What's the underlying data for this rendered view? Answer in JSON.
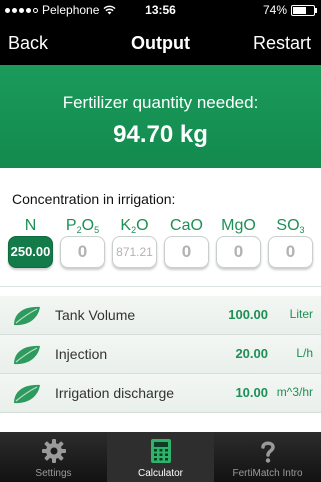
{
  "status_bar": {
    "carrier": "Pelephone",
    "time": "13:56",
    "battery": "74%",
    "battery_level": 0.74
  },
  "nav": {
    "back_label": "Back",
    "title": "Output",
    "restart_label": "Restart"
  },
  "hero": {
    "label": "Fertilizer quantity needed:",
    "value": "94.70 kg"
  },
  "concentration": {
    "title": "Concentration in irrigation:",
    "elements": [
      {
        "symbol": "N",
        "sub": "",
        "symbol2": "",
        "sub2": "",
        "value": "250.00"
      },
      {
        "symbol": "P",
        "sub": "2",
        "symbol2": "O",
        "sub2": "5",
        "value": "0"
      },
      {
        "symbol": "K",
        "sub": "2",
        "symbol2": "O",
        "sub2": "",
        "value": "871.21"
      },
      {
        "symbol": "CaO",
        "sub": "",
        "symbol2": "",
        "sub2": "",
        "value": "0"
      },
      {
        "symbol": "MgO",
        "sub": "",
        "symbol2": "",
        "sub2": "",
        "value": "0"
      },
      {
        "symbol": "SO",
        "sub": "3",
        "symbol2": "",
        "sub2": "",
        "value": "0"
      }
    ]
  },
  "rows": [
    {
      "label": "Tank Volume",
      "value": "100.00",
      "unit": "Liter"
    },
    {
      "label": "Injection",
      "value": "20.00",
      "unit": "L/h"
    },
    {
      "label": "Irrigation discharge",
      "value": "10.00",
      "unit": "m^3/hr"
    }
  ],
  "tabs": [
    {
      "label": "Settings",
      "icon": "gear-icon"
    },
    {
      "label": "Calculator",
      "icon": "calculator-icon"
    },
    {
      "label": "FertiMatch Intro",
      "icon": "question-icon"
    }
  ],
  "colors": {
    "brand_green": "#1e8f55",
    "hero_green": "#1b9a5c",
    "active_box": "#137a49"
  }
}
